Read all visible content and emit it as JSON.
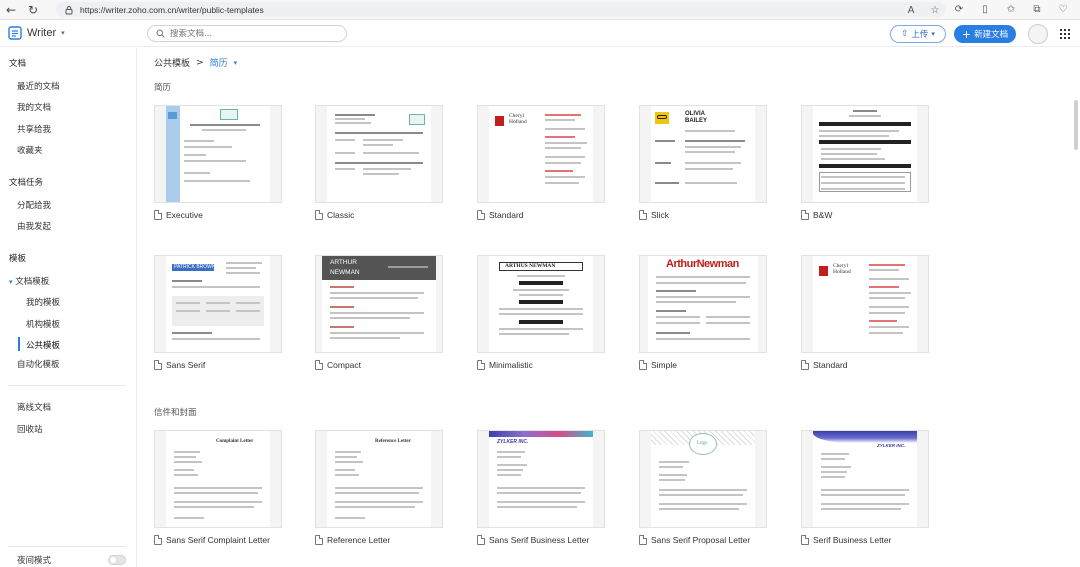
{
  "browser": {
    "url": "https://writer.zoho.com.cn/writer/public-templates"
  },
  "header": {
    "app_name": "Writer",
    "search_placeholder": "搜索文档...",
    "upload_label": "上传",
    "new_doc_label": "新建文档"
  },
  "sidebar": {
    "docs_head": "文档",
    "recent": "最近的文档",
    "my_docs": "我的文档",
    "shared": "共享给我",
    "favorites": "收藏夹",
    "tasks_head": "文档任务",
    "assigned": "分配给我",
    "initiated": "由我发起",
    "templates_head": "模板",
    "doc_templates": "文档模板",
    "my_templates": "我的模板",
    "org_templates": "机构模板",
    "public_templates": "公共模板",
    "automation_templates": "自动化模板",
    "offline": "离线文档",
    "trash": "回收站",
    "night_mode": "夜间模式"
  },
  "main": {
    "breadcrumb_root": "公共模板",
    "breadcrumb_sep": ">",
    "breadcrumb_current": "简历",
    "section_resume": "简历",
    "section_letters": "信件和封面",
    "resume_templates": [
      {
        "label": "Executive"
      },
      {
        "label": "Classic"
      },
      {
        "label": "Standard"
      },
      {
        "label": "Slick"
      },
      {
        "label": "B&W"
      },
      {
        "label": "Sans Serif"
      },
      {
        "label": "Compact"
      },
      {
        "label": "Minimalistic"
      },
      {
        "label": "Simple"
      },
      {
        "label": "Standard"
      }
    ],
    "letter_templates": [
      {
        "label": "Sans Serif Complaint Letter"
      },
      {
        "label": "Reference Letter"
      },
      {
        "label": "Sans Serif Business Letter"
      },
      {
        "label": "Sans Serif Proposal Letter"
      },
      {
        "label": "Serif Business Letter"
      }
    ],
    "thumb_text": {
      "cheryl_first": "Cheryl",
      "cheryl_last": "Holland",
      "olivia": "OLIVIA",
      "bailey": "BAILEY",
      "patrick": "PATRICK BROWN",
      "arthur": "ARTHUR",
      "newman": "NEWMAN",
      "arthus_newman": "ARTHUS NEWMAN",
      "arthur_newman": "ArthurNewman",
      "complaint_letter": "Complaint Letter",
      "reference_letter": "Reference Letter",
      "zylker": "ZYLKER INC.",
      "logo": "Logo",
      "zylker_corp": "ZYLKER INC."
    }
  }
}
